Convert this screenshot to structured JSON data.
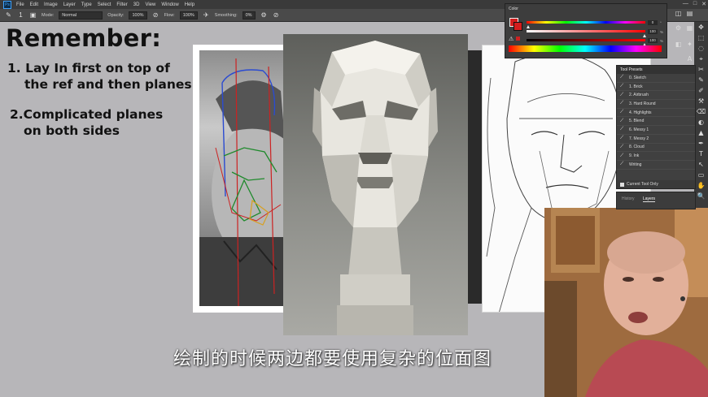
{
  "menubar": {
    "logo": "Ps",
    "items": [
      "File",
      "Edit",
      "Image",
      "Layer",
      "Type",
      "Select",
      "Filter",
      "3D",
      "View",
      "Window",
      "Help"
    ],
    "window_controls": [
      "—",
      "□",
      "✕"
    ]
  },
  "options_bar": {
    "brush_size": "1",
    "mode_label": "Mode:",
    "mode_value": "Normal",
    "opacity_label": "Opacity:",
    "opacity_value": "100%",
    "flow_label": "Flow:",
    "flow_value": "100%",
    "smoothing_label": "Smoothing:",
    "smoothing_value": "0%"
  },
  "slide": {
    "heading": "Remember:",
    "note1_line1": "1. Lay In first on top of",
    "note1_line2": "the ref and then planes",
    "note2_line1": "2.Complicated planes",
    "note2_line2": "on both sides"
  },
  "subtitle": "绘制的时候两边都要使用复杂的位面图",
  "color_panel": {
    "title": "Color",
    "foreground": "#d31d1d",
    "values": [
      "0",
      "100",
      "100"
    ],
    "unit": "%"
  },
  "tool_presets": {
    "title": "Tool Presets",
    "items": [
      "0. Sketch",
      "1. Brick",
      "2. Airbrush",
      "3. Hard Round",
      "4. Highlights",
      "5. Blend",
      "6. Messy 1",
      "7. Messy 2",
      "8. Cloud",
      "9. Ink",
      "Writing"
    ],
    "current_tool_only": "Current Tool Only"
  },
  "layers_panel": {
    "tabs": [
      "History",
      "Layers"
    ]
  },
  "right_toolbar": [
    "✥",
    "⬚",
    "◌",
    "⌖",
    "✂",
    "✎",
    "✐",
    "⚒",
    "⌫",
    "◐",
    "▲",
    "✒",
    "T",
    "↖",
    "▭",
    "✋",
    "🔍"
  ],
  "colors": {
    "ui_dark": "#3a3a3a",
    "canvas_bg": "#b7b6b9",
    "accent_red": "#d31d1d"
  }
}
